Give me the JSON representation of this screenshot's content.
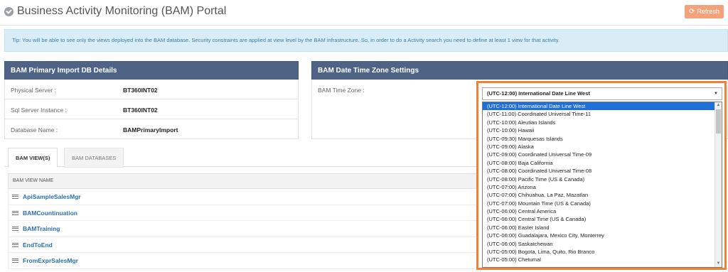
{
  "header": {
    "title": "Business Activity Monitoring (BAM) Portal",
    "refresh_label": "Refresh"
  },
  "tip": {
    "text": "Tip: You will be able to see only the views deployed into the BAM database. Security constraints are applied at view level by the BAM infrastructure. So, in order to do a Activity search you need to define at least 1 view for that activity."
  },
  "import_panel": {
    "title": "BAM Primary Import DB Details",
    "rows": [
      {
        "label": "Physical Server :",
        "value": "BT360INT02"
      },
      {
        "label": "Sql Server Instance :",
        "value": "BT360INT02"
      },
      {
        "label": "Database Name :",
        "value": "BAMPrimaryImport"
      }
    ]
  },
  "timezone_panel": {
    "title": "BAM Date Time Zone Settings",
    "label": "BAM Time Zone :",
    "selected": "(UTC-12:00) International Date Line West",
    "options": [
      "(UTC-12:00) International Date Line West",
      "(UTC-11:00) Coordinated Universal Time-11",
      "(UTC-10:00) Aleutian Islands",
      "(UTC-10:00) Hawaii",
      "(UTC-09:30) Marquesas Islands",
      "(UTC-09:00) Alaska",
      "(UTC-09:00) Coordinated Universal Time-09",
      "(UTC-08:00) Baja California",
      "(UTC-08:00) Coordinated Universal Time-08",
      "(UTC-08:00) Pacific Time (US & Canada)",
      "(UTC-07:00) Arizona",
      "(UTC-07:00) Chihuahua, La Paz, Mazatlan",
      "(UTC-07:00) Mountain Time (US & Canada)",
      "(UTC-06:00) Central America",
      "(UTC-06:00) Central Time (US & Canada)",
      "(UTC-06:00) Easter Island",
      "(UTC-06:00) Guadalajara, Mexico City, Monterrey",
      "(UTC-06:00) Saskatchewan",
      "(UTC-05:00) Bogota, Lima, Quito, Rio Branco",
      "(UTC-05:00) Chetumal"
    ]
  },
  "tabs": [
    {
      "label": "BAM VIEW(S)"
    },
    {
      "label": "BAM DATABASES"
    }
  ],
  "views_table": {
    "header": "BAM VIEW NAME",
    "rows": [
      "ApiSampleSalesMgr",
      "BAMCountinuation",
      "BAMTraining",
      "EndToEnd",
      "FromExprSalesMgr"
    ]
  },
  "colors": {
    "panel_header": "#4f6485",
    "highlight_border": "#ee8236",
    "refresh_button": "#f4a27c",
    "tip_background": "#d9edf7",
    "selected_option": "#1e6fd9",
    "link": "#2a6fb0"
  },
  "icons": {
    "logo": "check-circle-icon",
    "refresh": "refresh-icon",
    "view_row": "list-icon",
    "select_arrow": "caret-down-icon"
  }
}
